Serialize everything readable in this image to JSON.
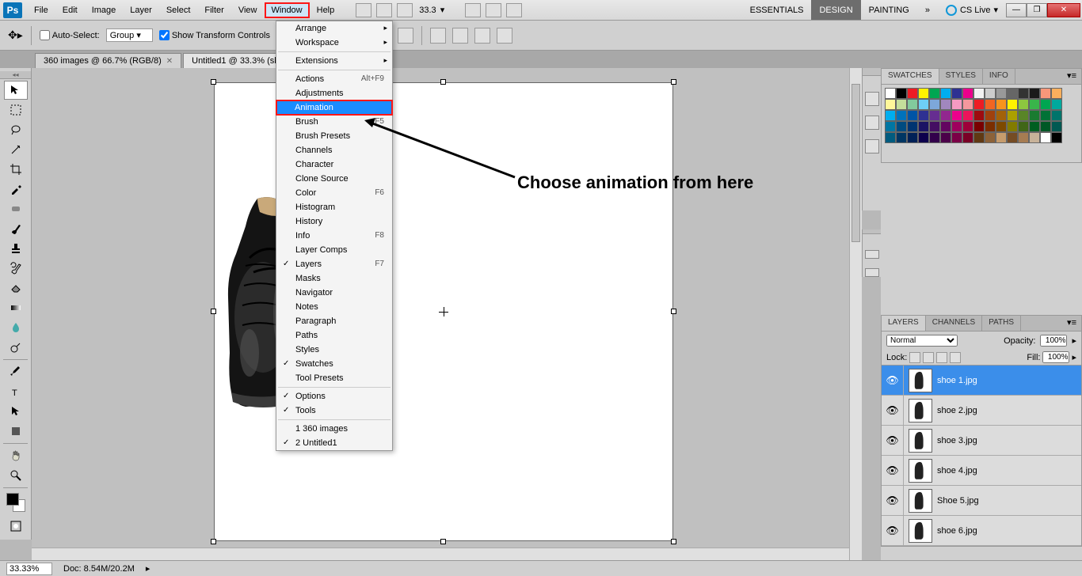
{
  "menubar": {
    "items": [
      "File",
      "Edit",
      "Image",
      "Layer",
      "Select",
      "Filter",
      "View",
      "Window",
      "Help"
    ],
    "zoom": "33.3",
    "workspaces": [
      "ESSENTIALS",
      "DESIGN",
      "PAINTING"
    ],
    "cslive": "CS Live"
  },
  "optionsbar": {
    "autoselect": "Auto-Select:",
    "autoselect_mode": "Group",
    "show_transform": "Show Transform Controls"
  },
  "tabs": [
    {
      "label": "360 images @ 66.7% (RGB/8)"
    },
    {
      "label": "Untitled1 @ 33.3% (sh"
    }
  ],
  "dropdown": {
    "groups": [
      [
        {
          "label": "Arrange",
          "sub": true
        },
        {
          "label": "Workspace",
          "sub": true
        }
      ],
      [
        {
          "label": "Extensions",
          "sub": true
        }
      ],
      [
        {
          "label": "Actions",
          "shortcut": "Alt+F9"
        },
        {
          "label": "Adjustments"
        },
        {
          "label": "Animation",
          "highlight": true
        },
        {
          "label": "Brush",
          "shortcut": "F5"
        },
        {
          "label": "Brush Presets"
        },
        {
          "label": "Channels"
        },
        {
          "label": "Character"
        },
        {
          "label": "Clone Source"
        },
        {
          "label": "Color",
          "shortcut": "F6"
        },
        {
          "label": "Histogram"
        },
        {
          "label": "History"
        },
        {
          "label": "Info",
          "shortcut": "F8"
        },
        {
          "label": "Layer Comps"
        },
        {
          "label": "Layers",
          "shortcut": "F7",
          "checked": true
        },
        {
          "label": "Masks"
        },
        {
          "label": "Navigator"
        },
        {
          "label": "Notes"
        },
        {
          "label": "Paragraph"
        },
        {
          "label": "Paths"
        },
        {
          "label": "Styles"
        },
        {
          "label": "Swatches",
          "checked": true
        },
        {
          "label": "Tool Presets"
        }
      ],
      [
        {
          "label": "Options",
          "checked": true
        },
        {
          "label": "Tools",
          "checked": true
        }
      ],
      [
        {
          "label": "1 360 images"
        },
        {
          "label": "2 Untitled1",
          "checked": true
        }
      ]
    ]
  },
  "annotation": "Choose animation from here",
  "panels": {
    "swatches_tabs": [
      "SWATCHES",
      "STYLES",
      "INFO"
    ],
    "layers_tabs": [
      "LAYERS",
      "CHANNELS",
      "PATHS"
    ],
    "blend_mode": "Normal",
    "opacity_label": "Opacity:",
    "opacity": "100%",
    "lock_label": "Lock:",
    "fill_label": "Fill:",
    "fill": "100%",
    "layers": [
      {
        "name": "shoe 1.jpg",
        "selected": true
      },
      {
        "name": "shoe 2.jpg"
      },
      {
        "name": "shoe 3.jpg"
      },
      {
        "name": "shoe 4.jpg"
      },
      {
        "name": "Shoe 5.jpg"
      },
      {
        "name": "shoe 6.jpg"
      }
    ]
  },
  "swatch_colors": [
    "#ffffff",
    "#000000",
    "#ed1c24",
    "#fff200",
    "#00a651",
    "#00aeef",
    "#2e3192",
    "#ec008c",
    "#f2f2f2",
    "#cccccc",
    "#999999",
    "#666666",
    "#333333",
    "#1a1a1a",
    "#f7977a",
    "#fbaf5d",
    "#fff79a",
    "#c4df9b",
    "#82ca9d",
    "#6ecff6",
    "#7da7d9",
    "#a187be",
    "#f49ac2",
    "#f5989d",
    "#ed1c24",
    "#f26522",
    "#f7941d",
    "#fff200",
    "#8dc63f",
    "#39b54a",
    "#00a651",
    "#00a99d",
    "#00aeef",
    "#0072bc",
    "#0054a6",
    "#2e3192",
    "#662d91",
    "#92278f",
    "#ec008c",
    "#ed145b",
    "#9e0b0f",
    "#a0410d",
    "#a36209",
    "#aba000",
    "#598527",
    "#1a7b30",
    "#007236",
    "#00746b",
    "#0076a3",
    "#004b80",
    "#003471",
    "#1b1464",
    "#440e62",
    "#630460",
    "#9e005d",
    "#9e0039",
    "#790000",
    "#7b2e00",
    "#7d4900",
    "#827b00",
    "#406618",
    "#005e20",
    "#005826",
    "#005952",
    "#005b7f",
    "#003663",
    "#002157",
    "#0d004c",
    "#32004b",
    "#4b0049",
    "#7b0046",
    "#7a0026",
    "#603913",
    "#8c6239",
    "#c69c6d",
    "#754c24",
    "#a67c52",
    "#c7b299",
    "#ffffff",
    "#000000"
  ],
  "statusbar": {
    "zoom": "33.33%",
    "doc": "Doc: 8.54M/20.2M"
  }
}
